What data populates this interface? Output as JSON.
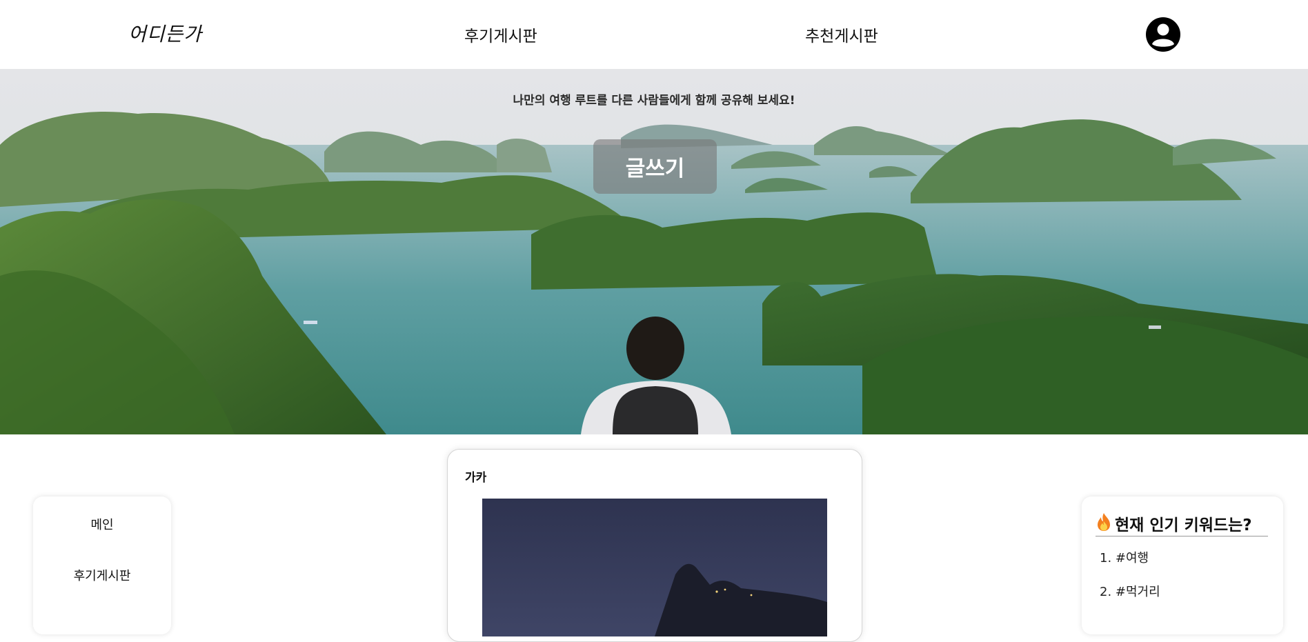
{
  "header": {
    "logo": "어디든가",
    "nav": [
      "후기게시판",
      "추천게시판"
    ],
    "profile_icon": "user-circle-icon"
  },
  "hero": {
    "subtitle": "나만의 여행 루트를 다른 사람들에게 함께 공유해 보세요!",
    "write_button": "글쓰기"
  },
  "sidebar": {
    "items": [
      "메인",
      "후기게시판"
    ]
  },
  "post": {
    "author": "가카"
  },
  "keywords": {
    "icon": "fire-icon",
    "title": "현재 인기 키워드는?",
    "items": [
      "1. #여행",
      "2. #먹거리"
    ]
  },
  "colors": {
    "header_bg": "#ffffff",
    "write_button_bg": "#787878",
    "card_border": "#d4d4d4"
  }
}
